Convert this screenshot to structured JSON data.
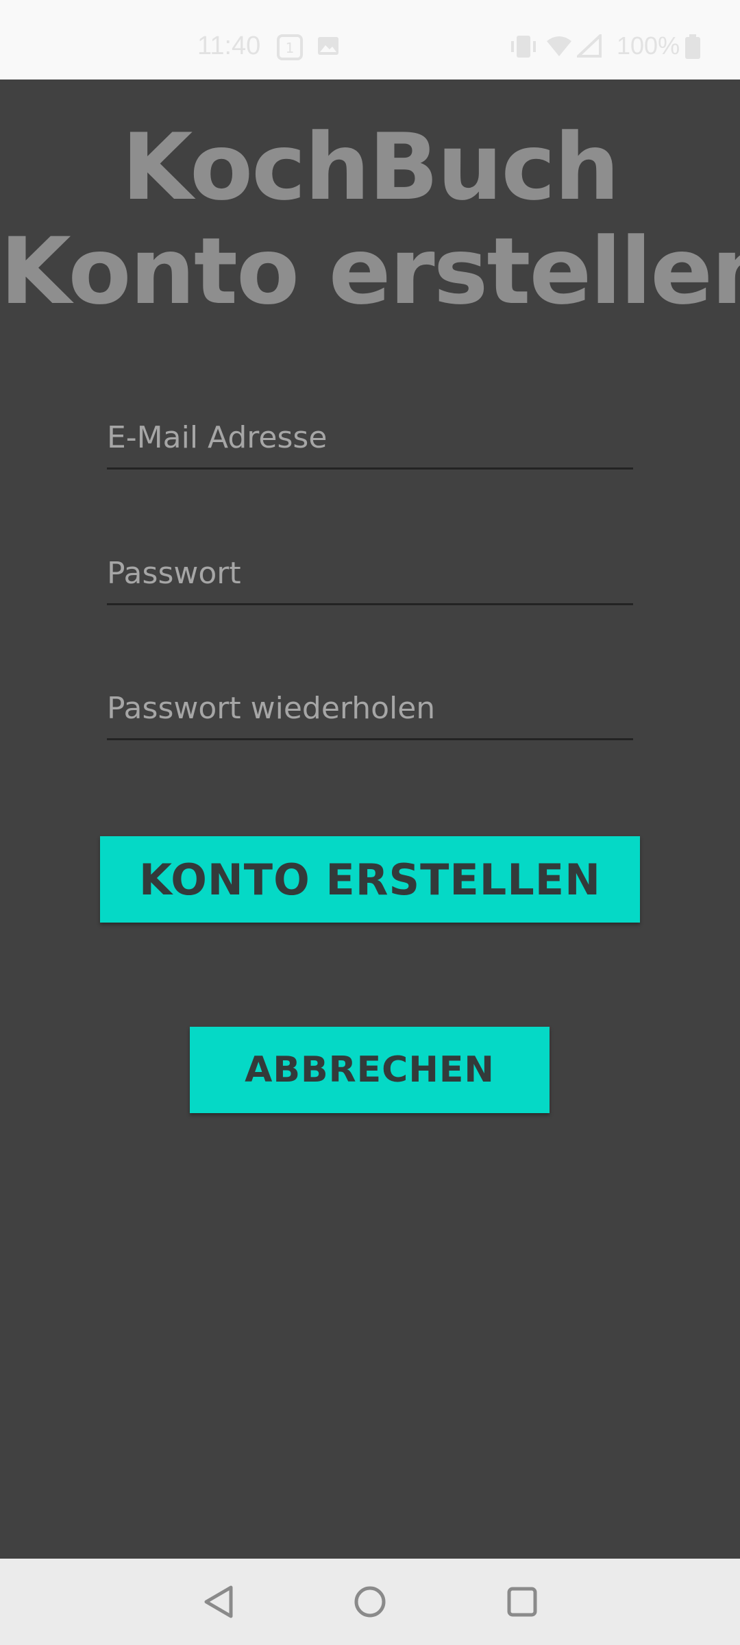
{
  "status_bar": {
    "time": "11:40",
    "battery_percent": "100%",
    "icons": [
      "notification-app-icon",
      "image-icon",
      "vibrate-icon",
      "wifi-icon",
      "signal-icon",
      "battery-icon"
    ]
  },
  "title": {
    "line1": "KochBuch",
    "line2": "Konto erstellen"
  },
  "form": {
    "email_placeholder": "E-Mail Adresse",
    "password_placeholder": "Passwort",
    "password_repeat_placeholder": "Passwort wiederholen",
    "email_value": "",
    "password_value": "",
    "password_repeat_value": ""
  },
  "buttons": {
    "create_account_label": "KONTO ERSTELLEN",
    "cancel_label": "ABBRECHEN"
  },
  "colors": {
    "background": "#414141",
    "accent": "#05d9c6",
    "title_text": "#8e8e8e"
  },
  "nav_bar": {
    "icons": [
      "back-icon",
      "home-icon",
      "recents-icon"
    ]
  }
}
